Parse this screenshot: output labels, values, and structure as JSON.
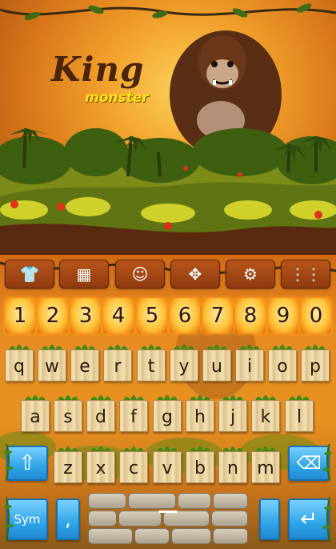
{
  "banner": {
    "title": "King",
    "subtitle": "monster"
  },
  "toolbar": {
    "buttons": [
      {
        "name": "theme-shirt-icon",
        "glyph": "👕"
      },
      {
        "name": "grid-apps-icon",
        "glyph": "▦"
      },
      {
        "name": "emoji-smiley-icon",
        "glyph": "☺"
      },
      {
        "name": "move-arrows-icon",
        "glyph": "✥"
      },
      {
        "name": "settings-gear-icon",
        "glyph": "⚙"
      },
      {
        "name": "menu-dots-icon",
        "glyph": "⋮⋮"
      }
    ]
  },
  "keyboard": {
    "numbers": [
      "1",
      "2",
      "3",
      "4",
      "5",
      "6",
      "7",
      "8",
      "9",
      "0"
    ],
    "row1": [
      "q",
      "w",
      "e",
      "r",
      "t",
      "y",
      "u",
      "i",
      "o",
      "p"
    ],
    "row2": [
      "a",
      "s",
      "d",
      "f",
      "g",
      "h",
      "j",
      "k",
      "l"
    ],
    "row3": [
      "z",
      "x",
      "c",
      "v",
      "b",
      "n",
      "m"
    ],
    "shift_glyph": "⇧",
    "backspace_glyph": "⌫",
    "sym_label": "Sym",
    "comma_label": ",",
    "enter_glyph": "↵"
  },
  "colors": {
    "accent_blue": "#2fa4e8",
    "wood": "#ecd6a4",
    "fire": "#ffc43a"
  }
}
